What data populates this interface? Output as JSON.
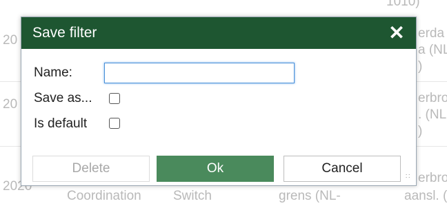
{
  "background": {
    "top_cut": "1010)",
    "row1": {
      "year": "20",
      "right_a": "erda",
      "right_b": "a (NL",
      "right_c": ")"
    },
    "row2": {
      "year": "20",
      "right_a": "erbro",
      "right_b": ". (NL",
      "right_c": ")"
    },
    "row3": {
      "year": "2020",
      "col2": "Coordination",
      "col3": "Switch",
      "col4": "grens (NL-",
      "right_a": "erbro",
      "right_b": "aansl. (NL"
    }
  },
  "dialog": {
    "title": "Save filter",
    "close_icon": "close-icon",
    "name_label": "Name:",
    "name_value": "",
    "save_as_label": "Save as...",
    "save_as_checked": false,
    "is_default_label": "Is default",
    "is_default_checked": false,
    "delete_label": "Delete",
    "ok_label": "Ok",
    "cancel_label": "Cancel",
    "colors": {
      "titlebar": "#1e5631",
      "ok": "#4a8a5c"
    }
  }
}
